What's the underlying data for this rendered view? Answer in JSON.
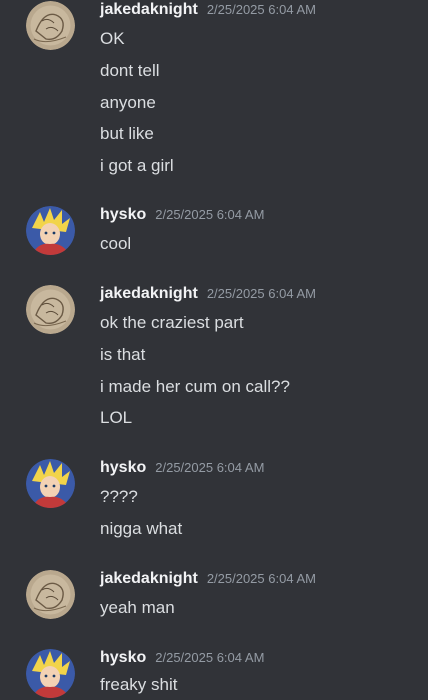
{
  "messages": [
    {
      "author": "jakedaknight",
      "avatar_icon": "sketch-avatar-icon",
      "timestamp": "2/25/2025 6:04 AM",
      "lines": [
        "OK",
        "dont tell",
        "anyone",
        "but like",
        "i got a girl"
      ]
    },
    {
      "author": "hysko",
      "avatar_icon": "anime-avatar-icon",
      "timestamp": "2/25/2025 6:04 AM",
      "lines": [
        "cool"
      ]
    },
    {
      "author": "jakedaknight",
      "avatar_icon": "sketch-avatar-icon",
      "timestamp": "2/25/2025 6:04 AM",
      "lines": [
        "ok the craziest part",
        "is that",
        "i made her cum on call??",
        "LOL"
      ]
    },
    {
      "author": "hysko",
      "avatar_icon": "anime-avatar-icon",
      "timestamp": "2/25/2025 6:04 AM",
      "lines": [
        "????",
        "nigga what"
      ]
    },
    {
      "author": "jakedaknight",
      "avatar_icon": "sketch-avatar-icon",
      "timestamp": "2/25/2025 6:04 AM",
      "lines": [
        "yeah man"
      ]
    },
    {
      "author": "hysko",
      "avatar_icon": "anime-avatar-icon",
      "timestamp": "2/25/2025 6:04 AM",
      "lines": [
        "freaky shit"
      ]
    }
  ],
  "colors": {
    "background": "#313338",
    "username": "#f2f3f5",
    "timestamp": "#949ba4",
    "message_text": "#dbdee1"
  }
}
